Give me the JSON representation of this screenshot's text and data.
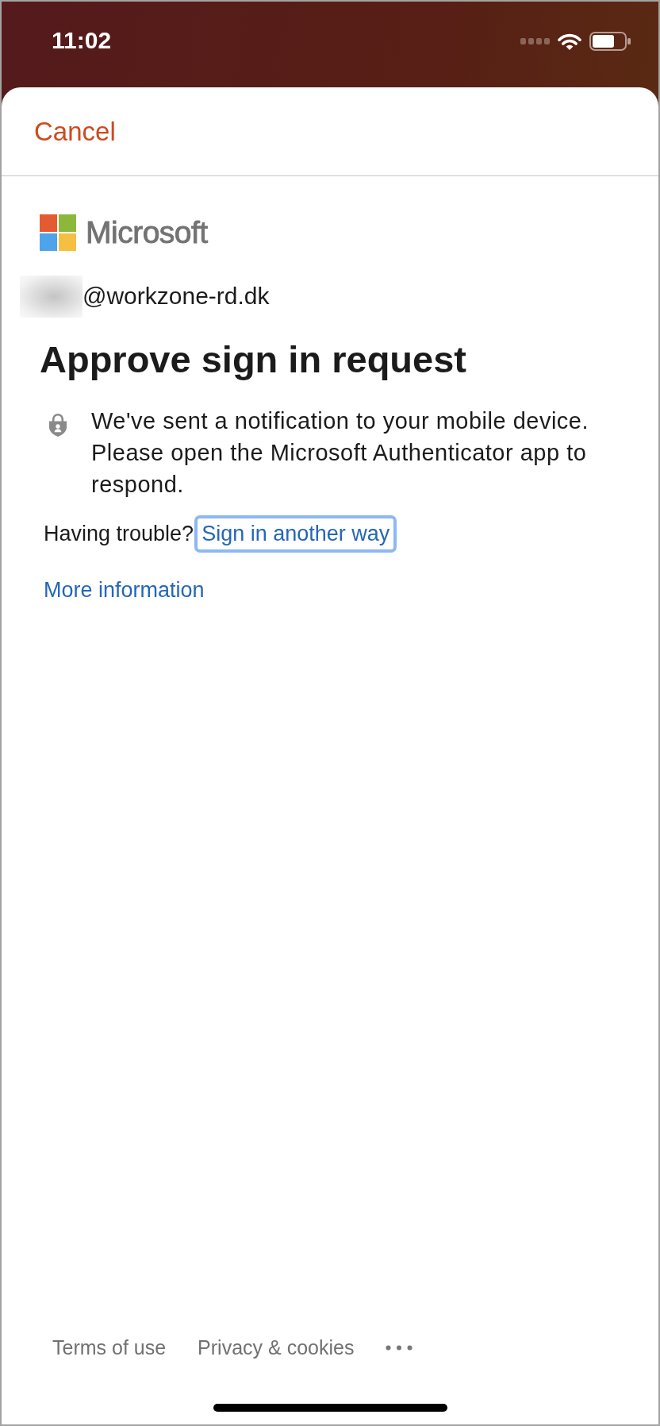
{
  "status_bar": {
    "time": "11:02"
  },
  "header": {
    "cancel": "Cancel"
  },
  "brand": {
    "name": "Microsoft"
  },
  "account": {
    "email": "@workzone-rd.dk"
  },
  "title": "Approve sign in request",
  "notice": {
    "text": "We've sent a notification to your mobile device. Please open the Microsoft Authenticator app to respond."
  },
  "help": {
    "prompt": "Having trouble?",
    "link": {
      "label": "Sign in another way",
      "focused": true
    }
  },
  "more_link": "More information",
  "footer": {
    "links": [
      "Terms of use",
      "Privacy & cookies"
    ]
  }
}
